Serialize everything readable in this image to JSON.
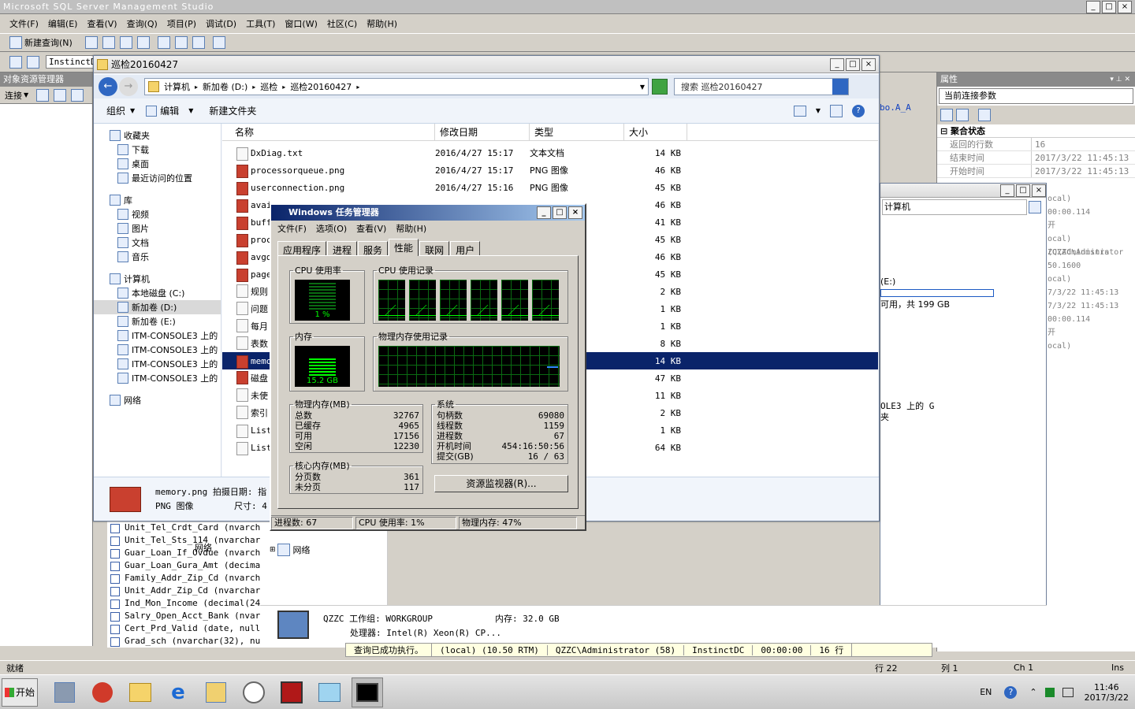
{
  "ssms": {
    "title": "Microsoft SQL Server Management Studio",
    "menu": [
      "文件(F)",
      "编辑(E)",
      "查看(V)",
      "查询(Q)",
      "项目(P)",
      "调试(D)",
      "工具(T)",
      "窗口(W)",
      "社区(C)",
      "帮助(H)"
    ],
    "new_query": "新建查询(N)",
    "instance_tab": "InstinctD",
    "status": "就绪",
    "row": "行 22",
    "col": "列 1",
    "ch": "Ch 1",
    "ins": "Ins"
  },
  "object_explorer": {
    "title": "对象资源管理器",
    "connect": "连接",
    "columns": [
      "Unit_Tel_Crdt_Card (nvarchar",
      "Unit_Tel_Sts_114 (nvarchar(2",
      "Guar_Loan_If_Ovdue (nvarchar",
      "Guar_Loan_Gura_Amt (decimal(2",
      "Family_Addr_Zip_Cd (nvarchar",
      "Unit_Addr_Zip_Cd (nvarchar(2",
      "Ind_Mon_Income (decimal(24,6",
      "Salry_Open_Acct_Bank (nvarcha",
      "Cert_Prd_Valid (date, null)",
      "Grad_sch (nvarchar(32), null"
    ]
  },
  "properties": {
    "title": "属性",
    "selector": "当前连接参数",
    "section": "聚合状态",
    "rows": [
      {
        "k": "返回的行数",
        "v": "16"
      },
      {
        "k": "结束时间",
        "v": "2017/3/22 11:45:13"
      },
      {
        "k": "开始时间",
        "v": "2017/3/22 11:45:13"
      }
    ],
    "partial": [
      "ocal)",
      "00:00.114",
      "开",
      "ocal) (QZZC\\Adminis",
      "ZC\\Administrator",
      "50.1600",
      "ocal)",
      "7/3/22 11:45:13",
      "7/3/22 11:45:13",
      "00:00.114",
      "开",
      "ocal)"
    ],
    "code": "bo.A_A"
  },
  "explorer": {
    "title": "巡检20160427",
    "breadcrumb": [
      "计算机",
      "新加卷 (D:)",
      "巡检",
      "巡检20160427"
    ],
    "search": "搜索 巡检20160427",
    "cmd": [
      "组织",
      "编辑",
      "新建文件夹"
    ],
    "nav": {
      "favorites": "收藏夹",
      "fav_items": [
        "下载",
        "桌面",
        "最近访问的位置"
      ],
      "library": "库",
      "lib_items": [
        "视频",
        "图片",
        "文档",
        "音乐"
      ],
      "computer": "计算机",
      "comp_items": [
        "本地磁盘 (C:)",
        "新加卷 (D:)",
        "新加卷 (E:)",
        "ITM-CONSOLE3 上的",
        "ITM-CONSOLE3 上的",
        "ITM-CONSOLE3 上的",
        "ITM-CONSOLE3 上的"
      ],
      "network": "网络"
    },
    "headers": [
      "名称",
      "修改日期",
      "类型",
      "大小"
    ],
    "files": [
      {
        "n": "DxDiag.txt",
        "d": "2016/4/27 15:17",
        "t": "文本文档",
        "s": "14 KB",
        "img": false
      },
      {
        "n": "processorqueue.png",
        "d": "2016/4/27 15:17",
        "t": "PNG 图像",
        "s": "46 KB",
        "img": true
      },
      {
        "n": "userconnection.png",
        "d": "2016/4/27 15:16",
        "t": "PNG 图像",
        "s": "45 KB",
        "img": true
      },
      {
        "n": "avai",
        "d": "",
        "t": "",
        "s": "46 KB",
        "img": true
      },
      {
        "n": "buff",
        "d": "",
        "t": "",
        "s": "41 KB",
        "img": true
      },
      {
        "n": "proc",
        "d": "",
        "t": "",
        "s": "45 KB",
        "img": true
      },
      {
        "n": "avgd",
        "d": "",
        "t": "",
        "s": "46 KB",
        "img": true
      },
      {
        "n": "page",
        "d": "",
        "t": "",
        "s": "45 KB",
        "img": true
      },
      {
        "n": "规则",
        "d": "",
        "t": "",
        "s": "2 KB",
        "img": false
      },
      {
        "n": "问题",
        "d": "",
        "t": "",
        "s": "1 KB",
        "img": false
      },
      {
        "n": "每月",
        "d": "",
        "t": "",
        "s": "1 KB",
        "img": false
      },
      {
        "n": "表数",
        "d": "",
        "t": "",
        "s": "8 KB",
        "img": false
      },
      {
        "n": "memo",
        "d": "",
        "t": "",
        "s": "14 KB",
        "img": true
      },
      {
        "n": "磁盘",
        "d": "",
        "t": "",
        "s": "47 KB",
        "img": true
      },
      {
        "n": "未使",
        "d": "",
        "t": "",
        "s": "11 KB",
        "img": false
      },
      {
        "n": "索引",
        "d": "",
        "t": "",
        "s": "2 KB",
        "img": false
      },
      {
        "n": "List",
        "d": "",
        "t": "",
        "s": "1 KB",
        "img": false
      },
      {
        "n": "List",
        "d": "",
        "t": "",
        "s": "64 KB",
        "img": false
      }
    ],
    "detail": {
      "name": "memory.png 拍摄日期: 指",
      "type": "PNG 图像",
      "size": "尺寸: 4"
    }
  },
  "sub_explorer": {
    "address": "计算机",
    "drive": "(E:)",
    "free": "可用，共 199 GB",
    "net": "网络",
    "share": "OLE3 上的 G",
    "share2": "夹"
  },
  "sysinfo": {
    "name": "QZZC 工作组: WORKGROUP",
    "memory": "内存: 32.0 GB",
    "cpu": "处理器: Intel(R) Xeon(R) CP..."
  },
  "results": [
    "查询已成功执行。",
    "(local) (10.50 RTM)",
    "QZZC\\Administrator (58)",
    "InstinctDC",
    "00:00:00",
    "16 行"
  ],
  "taskmgr": {
    "title": "Windows 任务管理器",
    "menu": [
      "文件(F)",
      "选项(O)",
      "查看(V)",
      "帮助(H)"
    ],
    "tabs": [
      "应用程序",
      "进程",
      "服务",
      "性能",
      "联网",
      "用户"
    ],
    "cpu_usage": {
      "label": "CPU 使用率",
      "value": "1 %"
    },
    "cpu_hist": "CPU 使用记录",
    "mem": {
      "label": "内存",
      "value": "15.2 GB"
    },
    "mem_hist": "物理内存使用记录",
    "phys": {
      "label": "物理内存(MB)",
      "rows": [
        {
          "k": "总数",
          "v": "32767"
        },
        {
          "k": "已缓存",
          "v": "4965"
        },
        {
          "k": "可用",
          "v": "17156"
        },
        {
          "k": "空闲",
          "v": "12230"
        }
      ]
    },
    "kernel": {
      "label": "核心内存(MB)",
      "rows": [
        {
          "k": "分页数",
          "v": "361"
        },
        {
          "k": "未分页",
          "v": "117"
        }
      ]
    },
    "system": {
      "label": "系统",
      "rows": [
        {
          "k": "句柄数",
          "v": "69080"
        },
        {
          "k": "线程数",
          "v": "1159"
        },
        {
          "k": "进程数",
          "v": "67"
        },
        {
          "k": "开机时间",
          "v": "454:16:50:56"
        },
        {
          "k": "提交(GB)",
          "v": "16 / 63"
        }
      ]
    },
    "resmon": "资源监视器(R)...",
    "status": [
      "进程数: 67",
      "CPU 使用率: 1%",
      "物理内存: 47%"
    ]
  },
  "taskbar": {
    "start": "开始",
    "lang": "EN",
    "time": "11:46",
    "date": "2017/3/22"
  }
}
